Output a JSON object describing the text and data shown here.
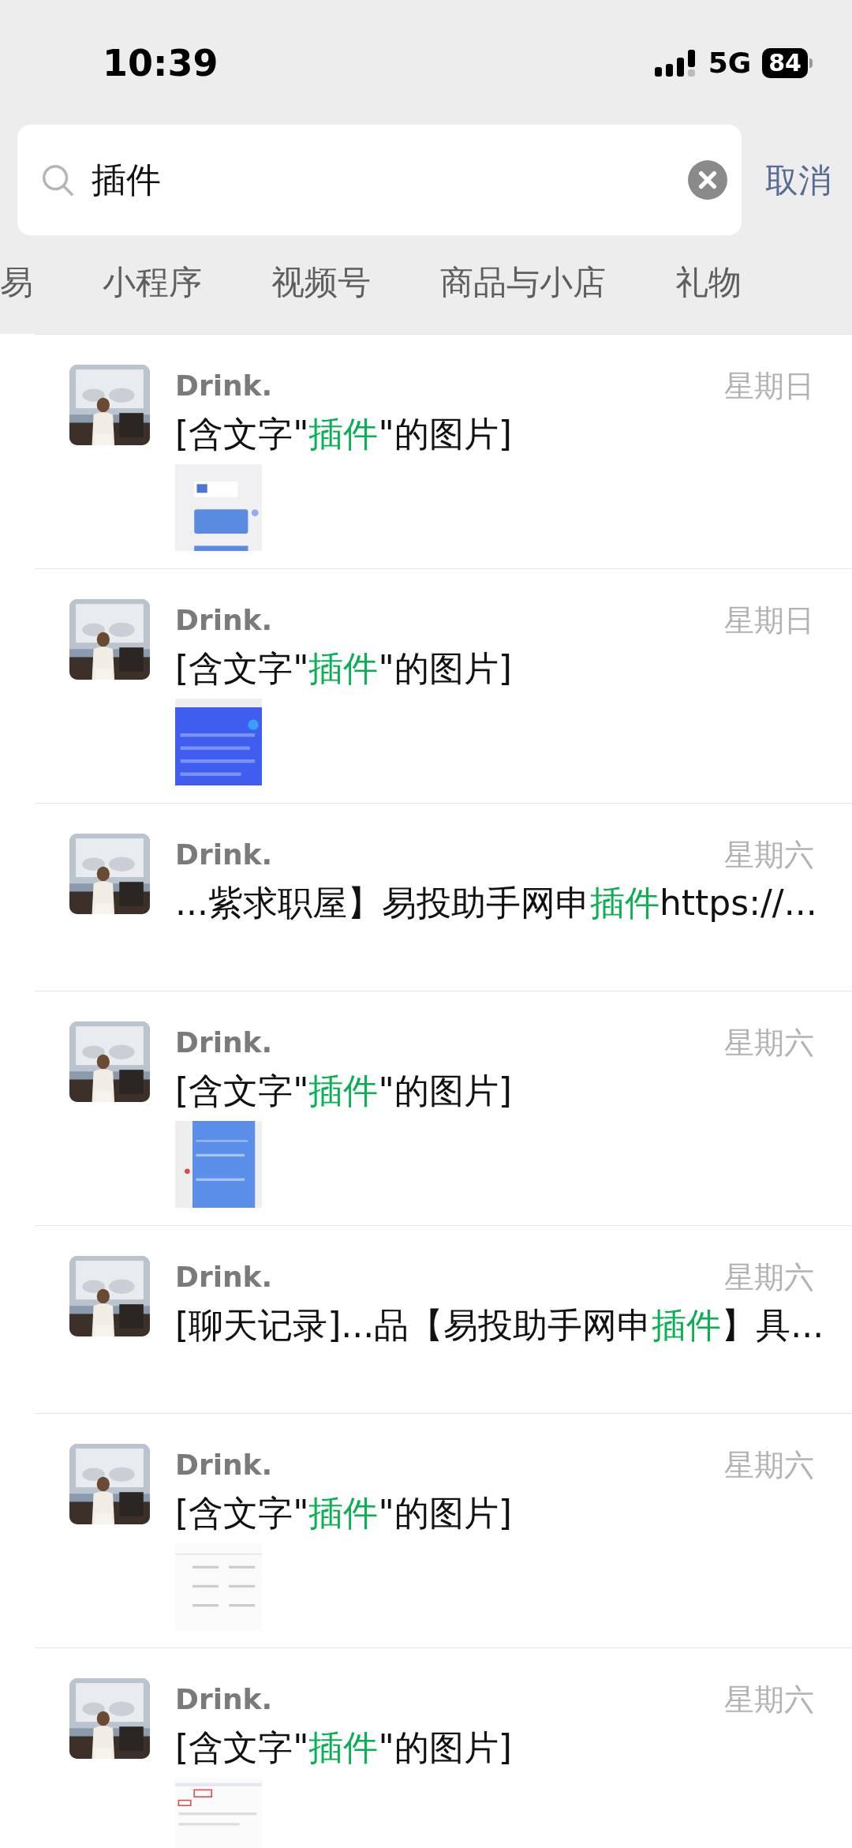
{
  "status_bar": {
    "time": "10:39",
    "network": "5G",
    "battery": "84"
  },
  "search": {
    "value": "插件",
    "cancel": "取消"
  },
  "tabs": [
    {
      "label": "易",
      "selected": false
    },
    {
      "label": "小程序",
      "selected": false
    },
    {
      "label": "视频号",
      "selected": false
    },
    {
      "label": "商品与小店",
      "selected": false
    },
    {
      "label": "礼物",
      "selected": false
    }
  ],
  "results": [
    {
      "name": "Drink.",
      "date": "星期日",
      "message": [
        {
          "text": "[含文字\"",
          "highlight": false
        },
        {
          "text": "插件",
          "highlight": true
        },
        {
          "text": "\"的图片]",
          "highlight": false
        }
      ]
    },
    {
      "name": "Drink.",
      "date": "星期日",
      "message": [
        {
          "text": "[含文字\"",
          "highlight": false
        },
        {
          "text": "插件",
          "highlight": true
        },
        {
          "text": "\"的图片]",
          "highlight": false
        }
      ]
    },
    {
      "kind": "text",
      "name": "Drink.",
      "date": "星期六",
      "message": [
        {
          "text": "...紫求职屋】易投助手网申",
          "highlight": false
        },
        {
          "text": "插件",
          "highlight": true
        },
        {
          "text": "https://...",
          "highlight": false
        }
      ]
    },
    {
      "name": "Drink.",
      "date": "星期六",
      "message": [
        {
          "text": "[含文字\"",
          "highlight": false
        },
        {
          "text": "插件",
          "highlight": true
        },
        {
          "text": "\"的图片]",
          "highlight": false
        }
      ]
    },
    {
      "kind": "text",
      "name": "Drink.",
      "date": "星期六",
      "message": [
        {
          "text": "[聊天记录]...品【易投助手网申",
          "highlight": false
        },
        {
          "text": "插件",
          "highlight": true
        },
        {
          "text": "】具...",
          "highlight": false
        }
      ]
    },
    {
      "name": "Drink.",
      "date": "星期六",
      "message": [
        {
          "text": "[含文字\"",
          "highlight": false
        },
        {
          "text": "插件",
          "highlight": true
        },
        {
          "text": "\"的图片]",
          "highlight": false
        }
      ]
    },
    {
      "name": "Drink.",
      "date": "星期六",
      "message": [
        {
          "text": "[含文字\"",
          "highlight": false
        },
        {
          "text": "插件",
          "highlight": true
        },
        {
          "text": "\"的图片]",
          "highlight": false
        }
      ]
    }
  ]
}
